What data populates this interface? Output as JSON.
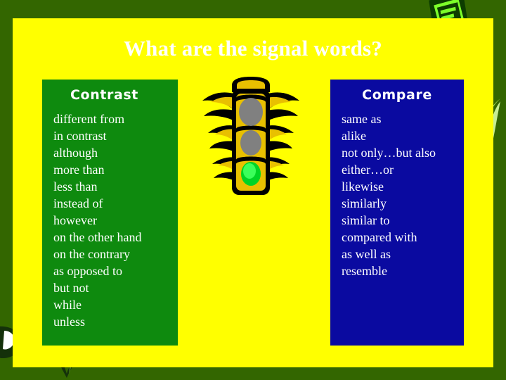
{
  "slide": {
    "title": "What are the signal words?",
    "background_color": "#336600",
    "panel_color": "#ffff00",
    "title_color": "#ffffff"
  },
  "contrast_box": {
    "heading": "Contrast",
    "background_color": "#0e8a0e",
    "words": [
      "different from",
      "in contrast",
      "although",
      "more than",
      "less than",
      "instead of",
      "however",
      "on the other hand",
      "on the contrary",
      "as opposed to",
      "but not",
      "while",
      "unless"
    ]
  },
  "compare_box": {
    "heading": "Compare",
    "background_color": "#0a0aa0",
    "words": [
      "same as",
      "alike",
      "not only…but also",
      "either…or",
      "likewise",
      "similarly",
      "similar to",
      "compared with",
      "as well as",
      "resemble"
    ]
  },
  "graphics": {
    "traffic_light": {
      "name": "winged-traffic-light",
      "body_color": "#e8c000",
      "outline_color": "#000000",
      "lamps": [
        {
          "name": "red-lamp",
          "state": "off",
          "color": "#808080"
        },
        {
          "name": "amber-lamp",
          "state": "off",
          "color": "#808080"
        },
        {
          "name": "green-lamp",
          "state": "on",
          "color": "#00d425"
        }
      ]
    },
    "book_icon": {
      "name": "book-icon",
      "color": "#7dff2a"
    },
    "leaf_right": {
      "name": "leaf-icon",
      "color": "#a8e05a"
    },
    "leaf_left": {
      "name": "leaf-icon",
      "color": "#14310a"
    },
    "sprout_bottom": {
      "name": "sprout-icon",
      "color": "#14310a"
    }
  }
}
